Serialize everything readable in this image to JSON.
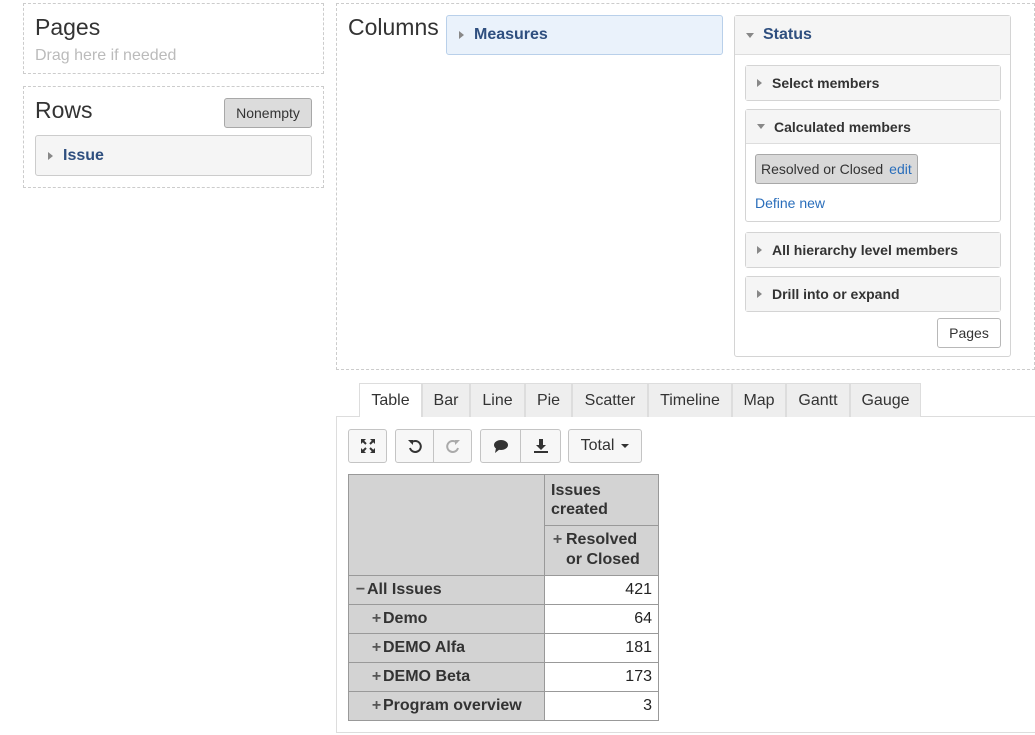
{
  "pages_zone": {
    "title": "Pages",
    "hint": "Drag here if needed"
  },
  "rows_zone": {
    "title": "Rows",
    "nonempty_label": "Nonempty",
    "dimension": "Issue"
  },
  "columns_zone": {
    "title": "Columns",
    "dimension": "Measures"
  },
  "status_panel": {
    "title": "Status",
    "select_members": "Select members",
    "calculated_members": "Calculated members",
    "calc_member_name": "Resolved or Closed",
    "calc_member_edit": "edit",
    "define_new": "Define new",
    "all_hierarchy": "All hierarchy level members",
    "drill": "Drill into or expand",
    "pages_button": "Pages"
  },
  "tabs": [
    "Table",
    "Bar",
    "Line",
    "Pie",
    "Scatter",
    "Timeline",
    "Map",
    "Gantt",
    "Gauge"
  ],
  "active_tab": "Table",
  "toolbar": {
    "icons": [
      "expand-icon",
      "undo-icon",
      "redo-icon",
      "comment-icon",
      "download-icon"
    ],
    "total_label": "Total"
  },
  "table": {
    "header_measure": "Issues created",
    "header_member": "Resolved or Closed",
    "header_member_expander": "+",
    "rows": [
      {
        "expander": "−",
        "label": "All Issues",
        "value": "421"
      },
      {
        "expander": "+",
        "label": "Demo",
        "value": "64"
      },
      {
        "expander": "+",
        "label": "DEMO Alfa",
        "value": "181"
      },
      {
        "expander": "+",
        "label": "DEMO Beta",
        "value": "173"
      },
      {
        "expander": "+",
        "label": "Program overview",
        "value": "3"
      }
    ]
  }
}
